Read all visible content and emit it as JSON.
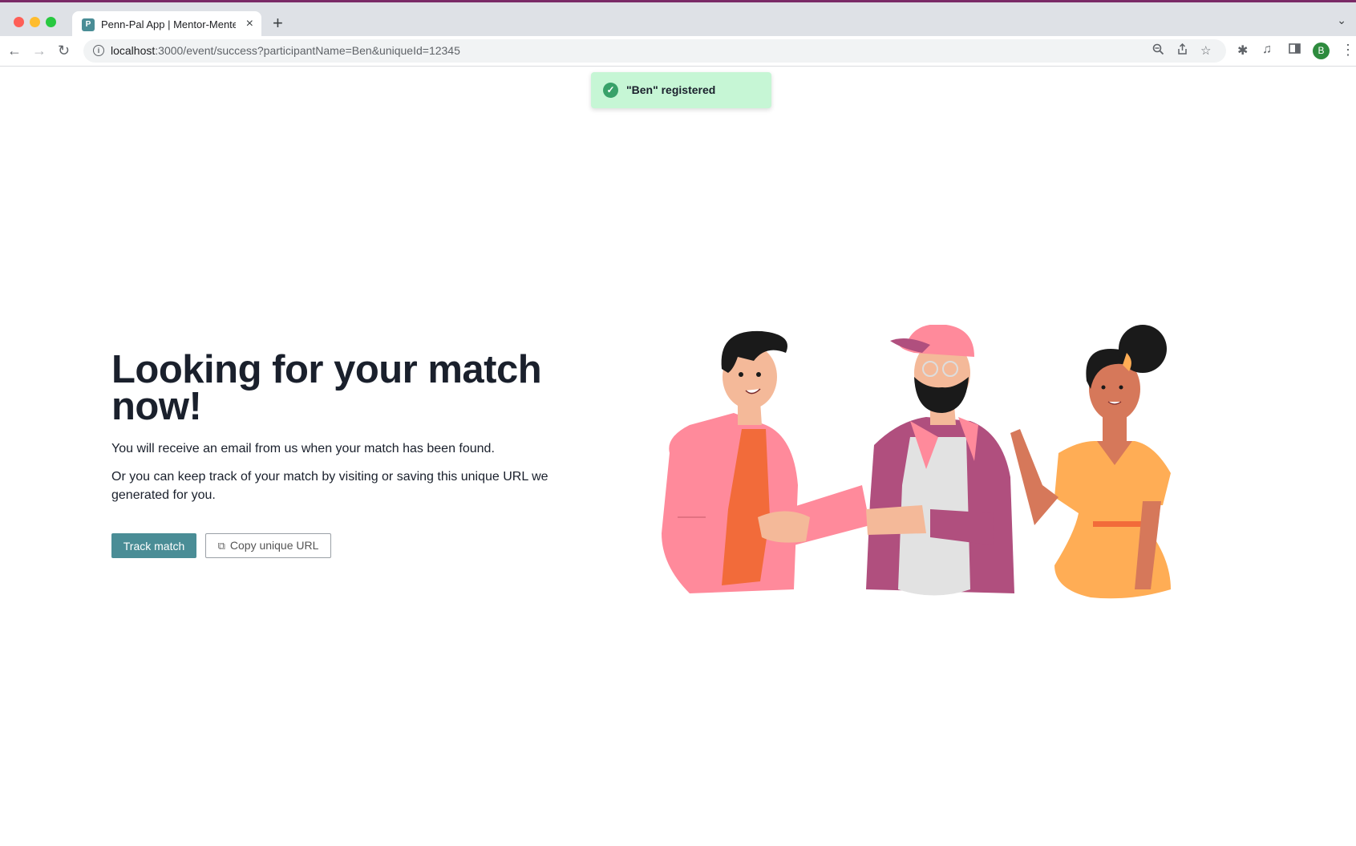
{
  "browser": {
    "tab_title": "Penn-Pal App | Mentor-Mentee",
    "tab_favicon": "P",
    "url_host": "localhost",
    "url_rest": ":3000/event/success?participantName=Ben&uniqueId=12345",
    "profile_initial": "B",
    "icons": [
      "back-icon",
      "forward-icon",
      "reload-icon",
      "info-icon",
      "zoom-icon",
      "share-icon",
      "star-icon",
      "extensions-icon",
      "media-icon",
      "side-panel-icon",
      "menu-icon"
    ]
  },
  "toast": {
    "message": "\"Ben\" registered",
    "status_color": "#38a169"
  },
  "main": {
    "heading": "Looking for your match now!",
    "paragraph_1": "You will receive an email from us when your match has been found.",
    "paragraph_2": "Or you can keep track of your match by visiting or saving this unique URL we generated for you.",
    "track_button": "Track match",
    "copy_button": "Copy unique URL"
  },
  "colors": {
    "accent": "#4a8d96",
    "toast_bg": "#c6f6d5",
    "heading": "#1a202c"
  }
}
